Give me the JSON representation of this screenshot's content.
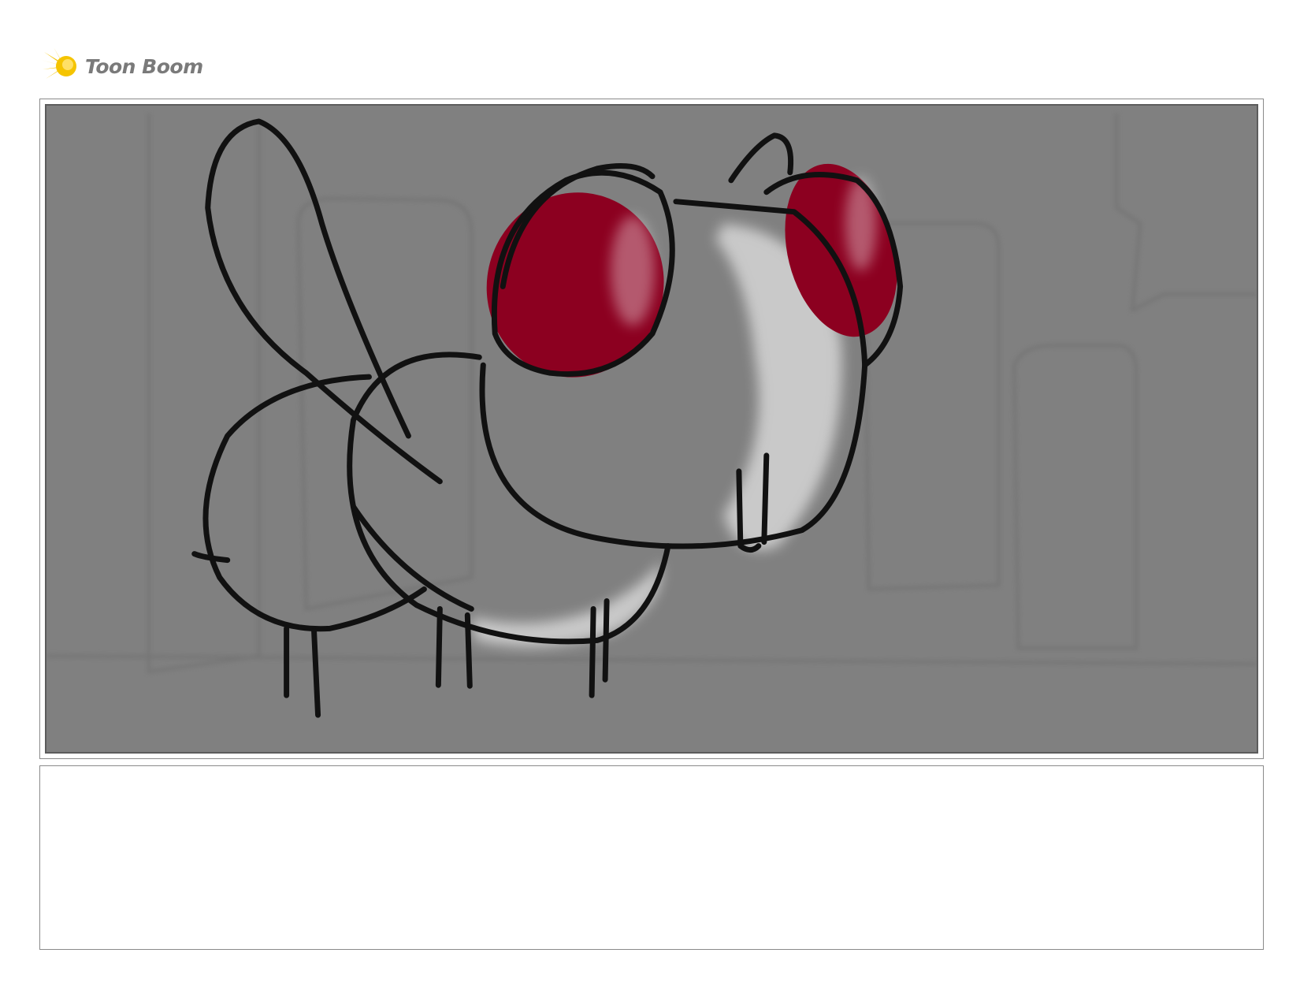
{
  "brand": {
    "name": "Toon Boom",
    "logo_icon": "starburst-icon",
    "accent_color": "#f5c400",
    "text_color": "#7a7a7a"
  },
  "panel": {
    "background_color": "#808080",
    "sketch_colors": {
      "ink": "#111111",
      "eye": "#8c0020",
      "highlight": "#d6d6d6"
    }
  },
  "caption": {
    "text": ""
  }
}
